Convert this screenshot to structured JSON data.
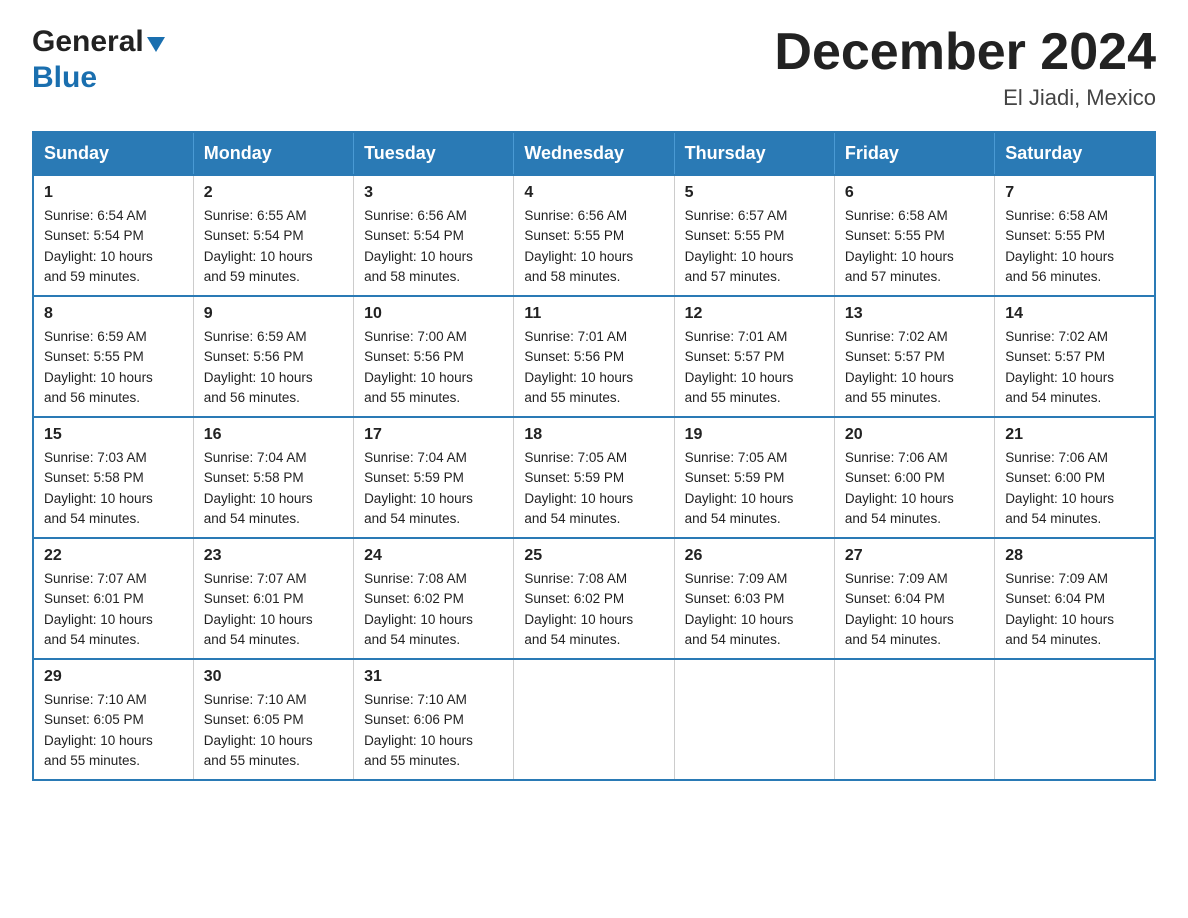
{
  "header": {
    "logo_general": "General",
    "logo_blue": "Blue",
    "title": "December 2024",
    "location": "El Jiadi, Mexico"
  },
  "days_of_week": [
    "Sunday",
    "Monday",
    "Tuesday",
    "Wednesday",
    "Thursday",
    "Friday",
    "Saturday"
  ],
  "weeks": [
    [
      {
        "day": "1",
        "sunrise": "6:54 AM",
        "sunset": "5:54 PM",
        "daylight": "10 hours and 59 minutes."
      },
      {
        "day": "2",
        "sunrise": "6:55 AM",
        "sunset": "5:54 PM",
        "daylight": "10 hours and 59 minutes."
      },
      {
        "day": "3",
        "sunrise": "6:56 AM",
        "sunset": "5:54 PM",
        "daylight": "10 hours and 58 minutes."
      },
      {
        "day": "4",
        "sunrise": "6:56 AM",
        "sunset": "5:55 PM",
        "daylight": "10 hours and 58 minutes."
      },
      {
        "day": "5",
        "sunrise": "6:57 AM",
        "sunset": "5:55 PM",
        "daylight": "10 hours and 57 minutes."
      },
      {
        "day": "6",
        "sunrise": "6:58 AM",
        "sunset": "5:55 PM",
        "daylight": "10 hours and 57 minutes."
      },
      {
        "day": "7",
        "sunrise": "6:58 AM",
        "sunset": "5:55 PM",
        "daylight": "10 hours and 56 minutes."
      }
    ],
    [
      {
        "day": "8",
        "sunrise": "6:59 AM",
        "sunset": "5:55 PM",
        "daylight": "10 hours and 56 minutes."
      },
      {
        "day": "9",
        "sunrise": "6:59 AM",
        "sunset": "5:56 PM",
        "daylight": "10 hours and 56 minutes."
      },
      {
        "day": "10",
        "sunrise": "7:00 AM",
        "sunset": "5:56 PM",
        "daylight": "10 hours and 55 minutes."
      },
      {
        "day": "11",
        "sunrise": "7:01 AM",
        "sunset": "5:56 PM",
        "daylight": "10 hours and 55 minutes."
      },
      {
        "day": "12",
        "sunrise": "7:01 AM",
        "sunset": "5:57 PM",
        "daylight": "10 hours and 55 minutes."
      },
      {
        "day": "13",
        "sunrise": "7:02 AM",
        "sunset": "5:57 PM",
        "daylight": "10 hours and 55 minutes."
      },
      {
        "day": "14",
        "sunrise": "7:02 AM",
        "sunset": "5:57 PM",
        "daylight": "10 hours and 54 minutes."
      }
    ],
    [
      {
        "day": "15",
        "sunrise": "7:03 AM",
        "sunset": "5:58 PM",
        "daylight": "10 hours and 54 minutes."
      },
      {
        "day": "16",
        "sunrise": "7:04 AM",
        "sunset": "5:58 PM",
        "daylight": "10 hours and 54 minutes."
      },
      {
        "day": "17",
        "sunrise": "7:04 AM",
        "sunset": "5:59 PM",
        "daylight": "10 hours and 54 minutes."
      },
      {
        "day": "18",
        "sunrise": "7:05 AM",
        "sunset": "5:59 PM",
        "daylight": "10 hours and 54 minutes."
      },
      {
        "day": "19",
        "sunrise": "7:05 AM",
        "sunset": "5:59 PM",
        "daylight": "10 hours and 54 minutes."
      },
      {
        "day": "20",
        "sunrise": "7:06 AM",
        "sunset": "6:00 PM",
        "daylight": "10 hours and 54 minutes."
      },
      {
        "day": "21",
        "sunrise": "7:06 AM",
        "sunset": "6:00 PM",
        "daylight": "10 hours and 54 minutes."
      }
    ],
    [
      {
        "day": "22",
        "sunrise": "7:07 AM",
        "sunset": "6:01 PM",
        "daylight": "10 hours and 54 minutes."
      },
      {
        "day": "23",
        "sunrise": "7:07 AM",
        "sunset": "6:01 PM",
        "daylight": "10 hours and 54 minutes."
      },
      {
        "day": "24",
        "sunrise": "7:08 AM",
        "sunset": "6:02 PM",
        "daylight": "10 hours and 54 minutes."
      },
      {
        "day": "25",
        "sunrise": "7:08 AM",
        "sunset": "6:02 PM",
        "daylight": "10 hours and 54 minutes."
      },
      {
        "day": "26",
        "sunrise": "7:09 AM",
        "sunset": "6:03 PM",
        "daylight": "10 hours and 54 minutes."
      },
      {
        "day": "27",
        "sunrise": "7:09 AM",
        "sunset": "6:04 PM",
        "daylight": "10 hours and 54 minutes."
      },
      {
        "day": "28",
        "sunrise": "7:09 AM",
        "sunset": "6:04 PM",
        "daylight": "10 hours and 54 minutes."
      }
    ],
    [
      {
        "day": "29",
        "sunrise": "7:10 AM",
        "sunset": "6:05 PM",
        "daylight": "10 hours and 55 minutes."
      },
      {
        "day": "30",
        "sunrise": "7:10 AM",
        "sunset": "6:05 PM",
        "daylight": "10 hours and 55 minutes."
      },
      {
        "day": "31",
        "sunrise": "7:10 AM",
        "sunset": "6:06 PM",
        "daylight": "10 hours and 55 minutes."
      },
      null,
      null,
      null,
      null
    ]
  ],
  "labels": {
    "sunrise": "Sunrise:",
    "sunset": "Sunset:",
    "daylight": "Daylight:"
  }
}
